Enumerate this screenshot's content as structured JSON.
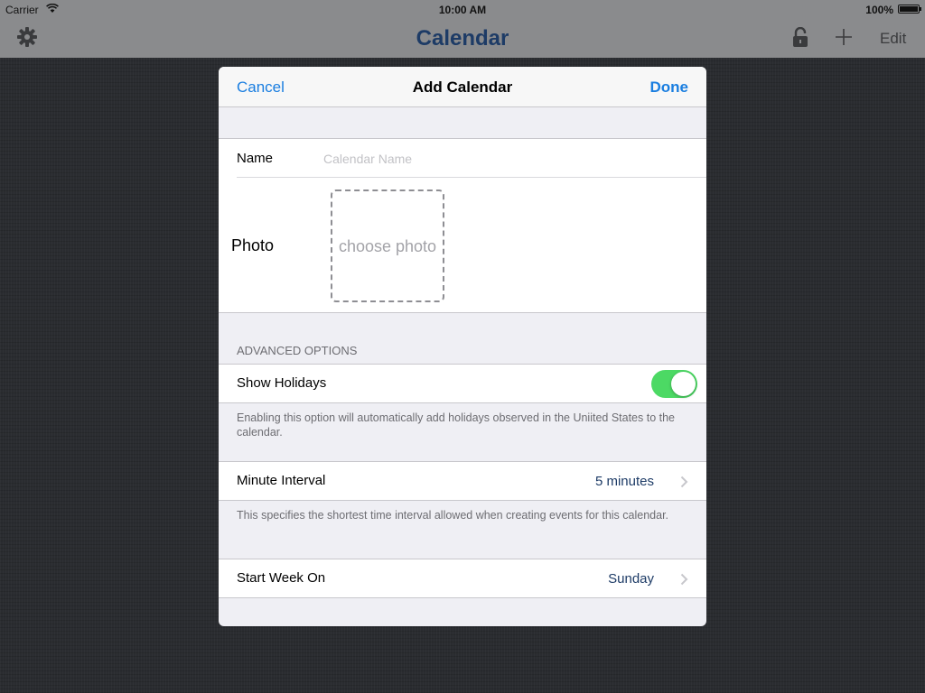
{
  "status_bar": {
    "carrier": "Carrier",
    "time": "10:00 AM",
    "battery": "100%"
  },
  "nav": {
    "title": "Calendar",
    "edit_label": "Edit",
    "icons": [
      "gear-icon",
      "lock-icon",
      "plus-icon"
    ]
  },
  "modal": {
    "cancel_label": "Cancel",
    "title": "Add Calendar",
    "done_label": "Done",
    "name_label": "Name",
    "name_value": "",
    "name_placeholder": "Calendar Name",
    "photo_label": "Photo",
    "photo_placeholder": "choose photo",
    "advanced_header": "ADVANCED OPTIONS",
    "show_holidays_label": "Show Holidays",
    "show_holidays_on": true,
    "holidays_note": "Enabling this option will automatically add holidays observed in the Uniited States to the calendar.",
    "minute_interval_label": "Minute Interval",
    "minute_interval_value": "5 minutes",
    "interval_note": "This specifies the shortest time interval allowed when creating events for this calendar.",
    "start_week_label": "Start Week On",
    "start_week_value": "Sunday"
  },
  "colors": {
    "accent": "#1a7ee0",
    "value_text": "#1d3b66",
    "toggle_on": "#4cd964"
  }
}
